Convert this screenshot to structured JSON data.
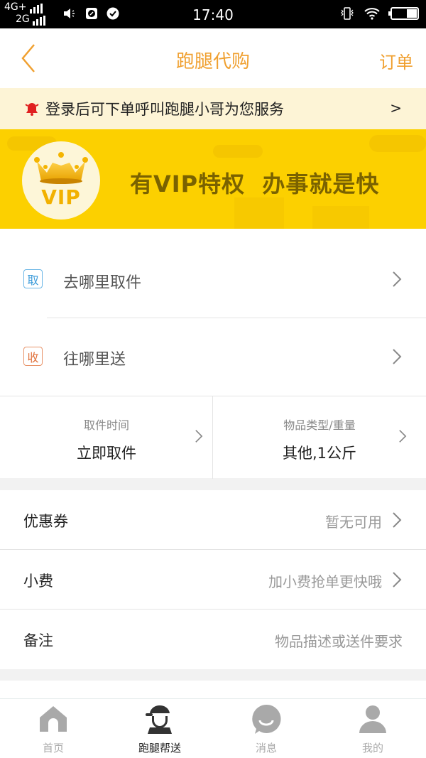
{
  "status_bar": {
    "network_1": "4G+",
    "network_2": "2G",
    "time": "17:40"
  },
  "header": {
    "title": "跑腿代购",
    "right_action": "订单",
    "back_icon": "chevron-left-icon"
  },
  "notice": {
    "icon": "bell-icon",
    "text": "登录后可下单呼叫跑腿小哥为您服务",
    "arrow": ">"
  },
  "vip_banner": {
    "badge_text": "VIP",
    "slogan": "有VIP特权  办事就是快"
  },
  "address": {
    "pickup": {
      "tag": "取",
      "label": "去哪里取件"
    },
    "delivery": {
      "tag": "收",
      "label": "往哪里送"
    }
  },
  "details": {
    "pickup_time": {
      "label": "取件时间",
      "value": "立即取件"
    },
    "item_type": {
      "label": "物品类型/重量",
      "value": "其他,1公斤"
    }
  },
  "options": [
    {
      "label": "优惠券",
      "value": "暂无可用",
      "chevron": true
    },
    {
      "label": "小费",
      "value": "加小费抢单更快哦",
      "chevron": true
    },
    {
      "label": "备注",
      "value": "物品描述或送件要求",
      "chevron": false
    }
  ],
  "tabbar": {
    "items": [
      {
        "label": "首页",
        "icon": "home-icon",
        "active": false
      },
      {
        "label": "跑腿帮送",
        "icon": "courier-icon",
        "active": true
      },
      {
        "label": "消息",
        "icon": "message-icon",
        "active": false
      },
      {
        "label": "我的",
        "icon": "user-icon",
        "active": false
      }
    ]
  },
  "colors": {
    "accent": "#f0a030",
    "banner_yellow": "#fcd000",
    "notice_bg": "#fdf4d6",
    "pickup_tag": "#3a9ad9",
    "delivery_tag": "#e0703a"
  }
}
